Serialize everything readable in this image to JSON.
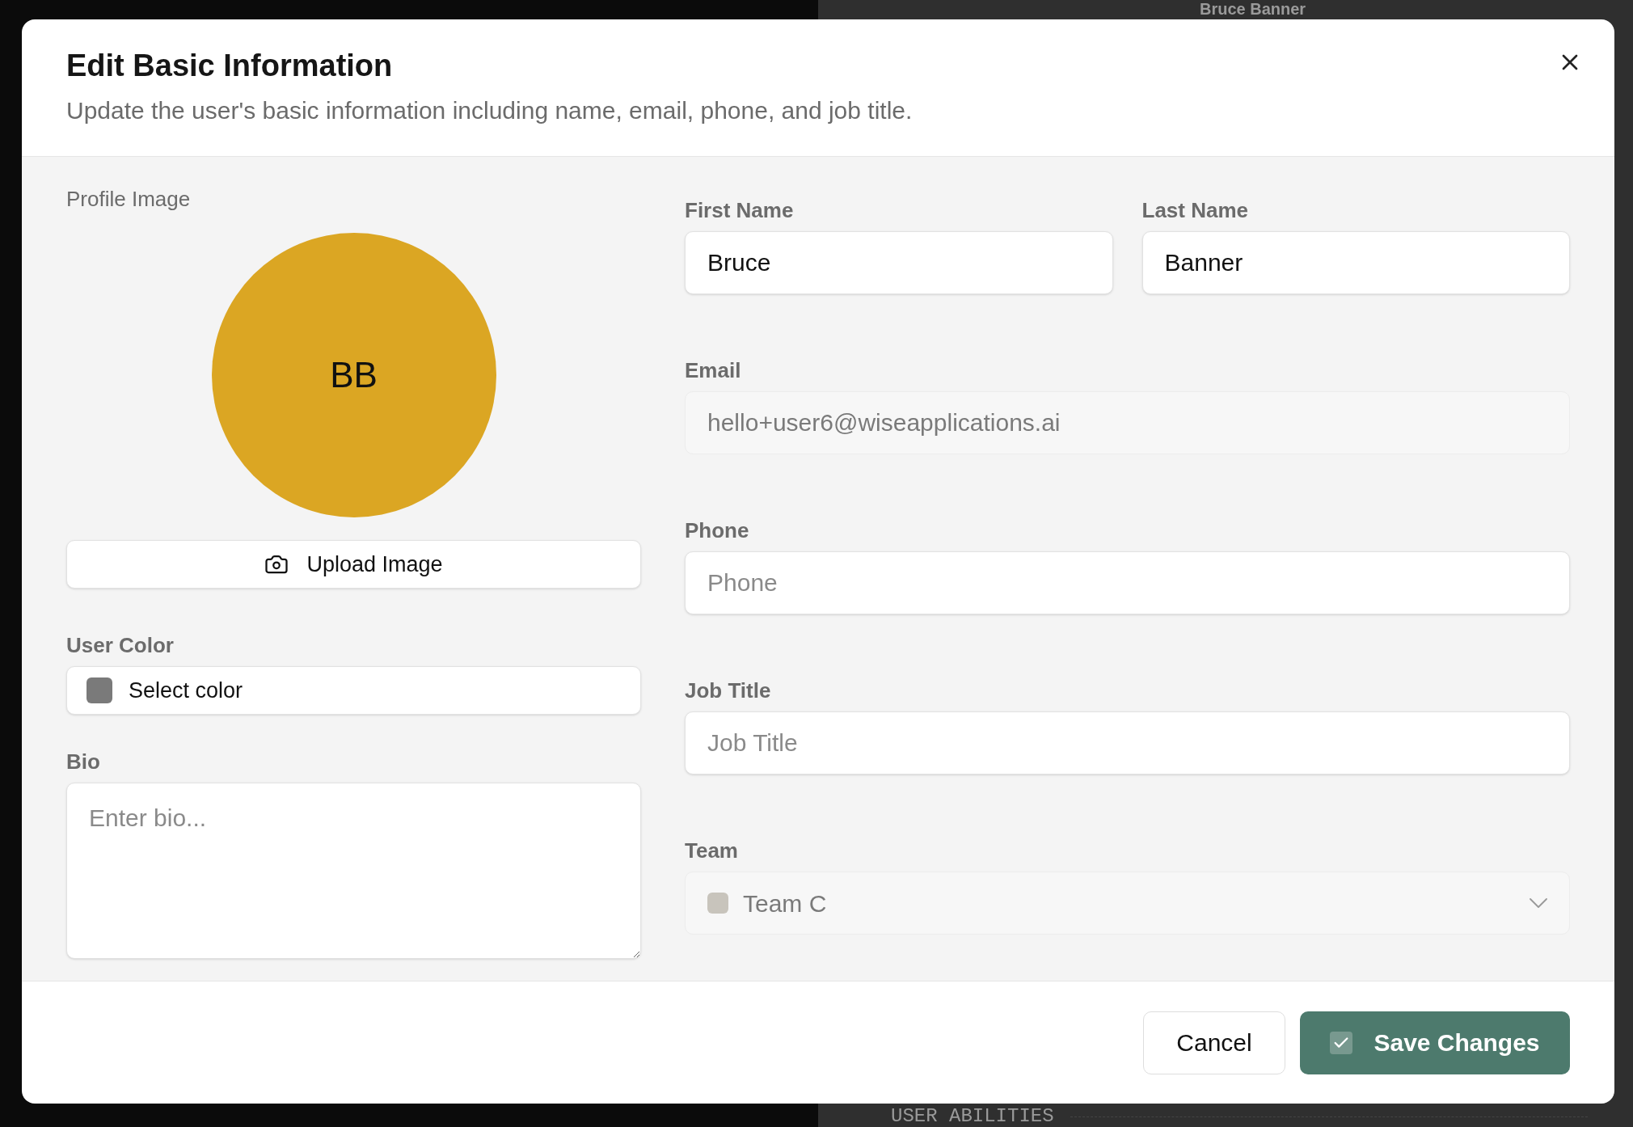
{
  "background": {
    "heading": "Bruce Banner",
    "section_title": "USER ABILITIES"
  },
  "dialog": {
    "title": "Edit Basic Information",
    "description": "Update the user's basic information including name, email, phone, and job title."
  },
  "profile": {
    "label": "Profile Image",
    "initials": "BB",
    "color": "#dba623",
    "upload_button": "Upload Image"
  },
  "user_color": {
    "label": "User Color",
    "value": "Select color",
    "color": "#7a7a7a"
  },
  "bio": {
    "label": "Bio",
    "placeholder": "Enter bio..."
  },
  "name_fields": [
    {
      "label": "First Name",
      "value": "Bruce",
      "disabled": false
    },
    {
      "label": "Last Name",
      "value": "Banner",
      "disabled": false
    }
  ],
  "fields": [
    {
      "label": "Email",
      "value": "hello+user6@wiseapplications.ai",
      "disabled": true
    },
    {
      "label": "Phone",
      "placeholder": "Phone",
      "disabled": false
    },
    {
      "label": "Job Title",
      "placeholder": "Job Title",
      "disabled": false
    }
  ],
  "team": {
    "label": "Team",
    "value": "Team C",
    "color": "#c8c4bc",
    "disabled": true
  },
  "buttons": {
    "cancel": "Cancel",
    "save": "Save Changes"
  }
}
